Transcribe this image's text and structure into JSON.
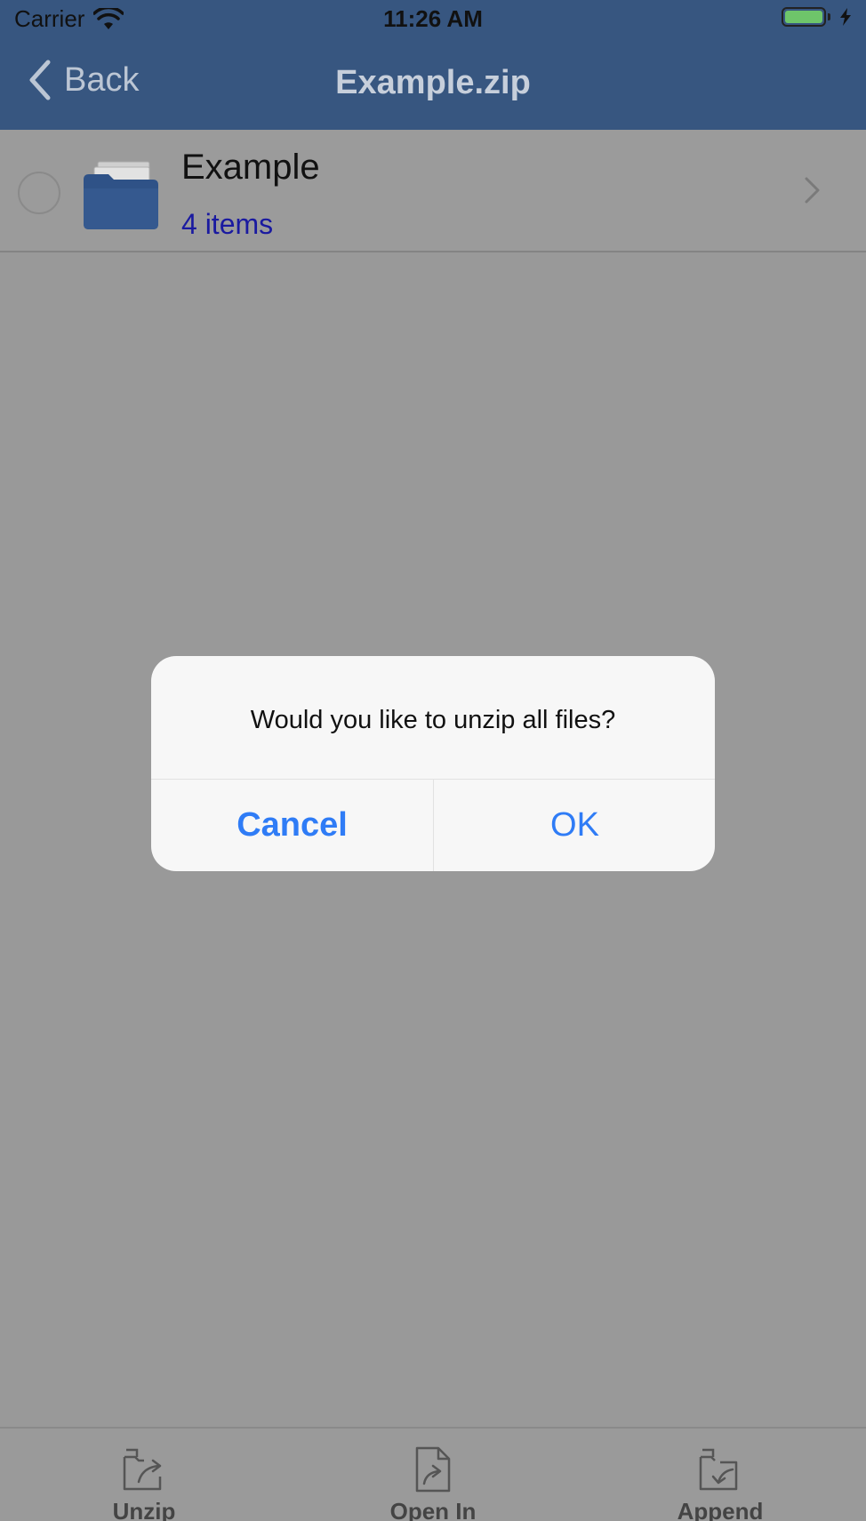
{
  "status_bar": {
    "carrier": "Carrier",
    "time": "11:26 AM",
    "battery_level": 1.0
  },
  "nav": {
    "back_label": "Back",
    "title": "Example.zip"
  },
  "list": {
    "items": [
      {
        "title": "Example",
        "subtitle": "4 items",
        "icon": "folder-icon"
      }
    ]
  },
  "alert": {
    "message": "Would you like to unzip all files?",
    "cancel_label": "Cancel",
    "ok_label": "OK"
  },
  "toolbar": {
    "unzip_label": "Unzip",
    "open_in_label": "Open In",
    "append_label": "Append"
  },
  "colors": {
    "nav_background": "#375680",
    "alert_button": "#2f7cf6",
    "subtitle": "#1a1aa0",
    "dim_overlay": "#999999"
  }
}
